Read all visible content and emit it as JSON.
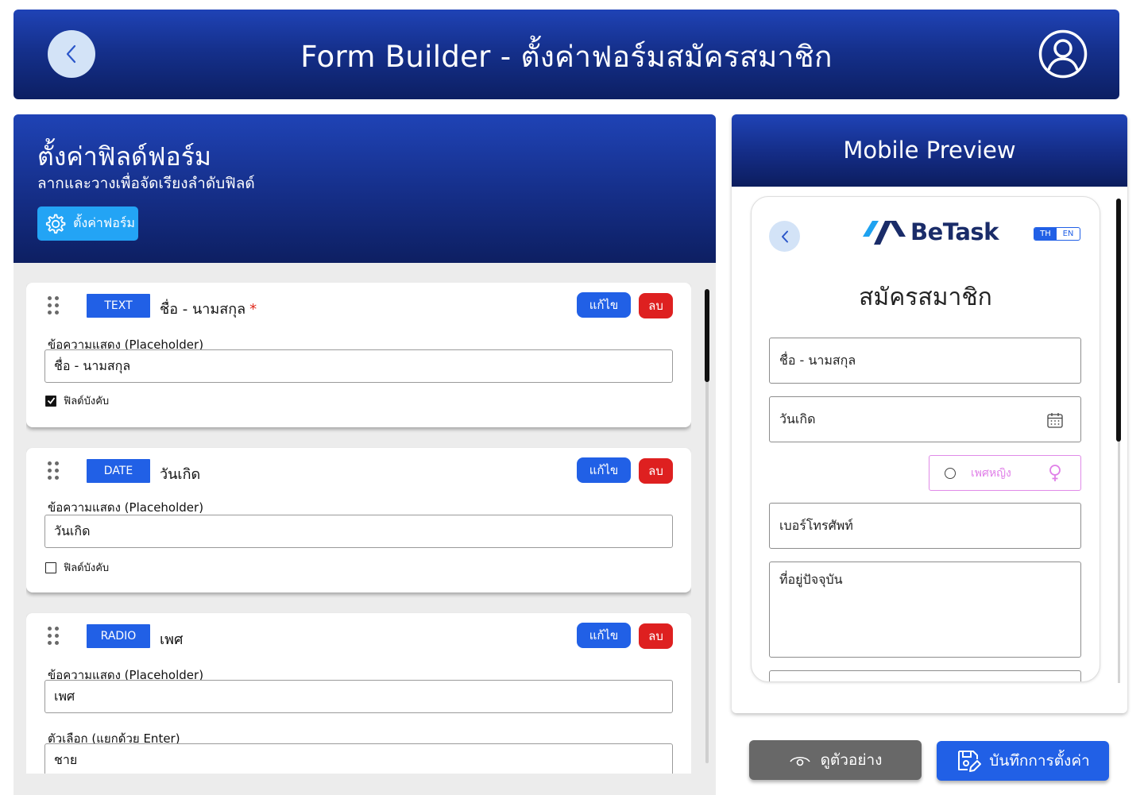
{
  "header": {
    "title": "Form Builder - ตั้งค่าฟอร์มสมัครสมาชิก",
    "back_icon": "chevron-left-icon",
    "user_icon": "user-circle-icon"
  },
  "left_panel": {
    "title": "ตั้งค่าฟิลด์ฟอร์ม",
    "subtitle": "ลากและวางเพื่อจัดเรียงลำดับฟิลด์",
    "settings_button": "ตั้งค่าฟอร์ม",
    "fields": [
      {
        "type": "TEXT",
        "label": "ชื่อ - นามสกุล",
        "required_marker": "*",
        "edit_label": "แก้ไข",
        "delete_label": "ลบ",
        "placeholder_label": "ข้อความแสดง (Placeholder)",
        "placeholder_value": "ชื่อ - นามสกุล",
        "required_label": "ฟิลด์บังคับ",
        "required": true
      },
      {
        "type": "DATE",
        "label": "วันเกิด",
        "edit_label": "แก้ไข",
        "delete_label": "ลบ",
        "placeholder_label": "ข้อความแสดง (Placeholder)",
        "placeholder_value": "วันเกิด",
        "required_label": "ฟิลด์บังคับ",
        "required": false
      },
      {
        "type": "RADIO",
        "label": "เพศ",
        "edit_label": "แก้ไข",
        "delete_label": "ลบ",
        "placeholder_label": "ข้อความแสดง (Placeholder)",
        "placeholder_value": "เพศ",
        "options_label": "ตัวเลือก (แยกด้วย Enter)",
        "options_value": "ชาย"
      }
    ]
  },
  "preview": {
    "title": "Mobile Preview",
    "brand": "BeTask",
    "lang_th": "TH",
    "lang_en": "EN",
    "form_title": "สมัครสมาชิก",
    "inputs": {
      "name": "ชื่อ - นามสกุล",
      "birthday": "วันเกิด",
      "gender_option": "เพศหญิง",
      "phone": "เบอร์โทรศัพท์",
      "address": "ที่อยู่ปัจจุบัน"
    }
  },
  "actions": {
    "preview_label": "ดูตัวอย่าง",
    "save_label": "บันทึกการตั้งค่า"
  },
  "colors": {
    "header_blue": "#1a3aa8",
    "primary": "#2160e6",
    "danger": "#de2020",
    "settings_blue": "#23a4f5",
    "gender_pink": "#e080e8",
    "preview_gray": "#686868"
  }
}
